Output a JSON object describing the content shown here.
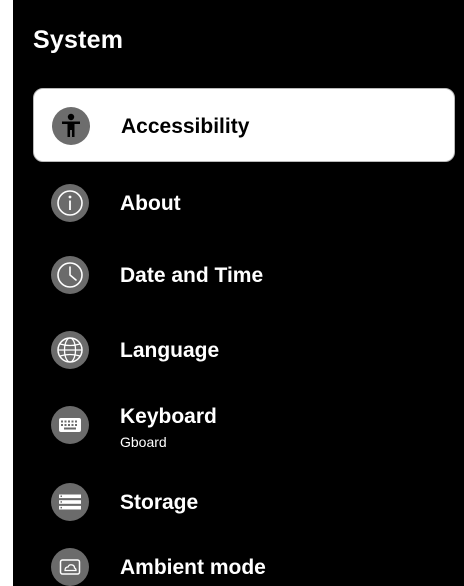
{
  "screen": {
    "title": "System",
    "items": [
      {
        "label": "Accessibility",
        "icon": "accessibility-icon",
        "selected": true
      },
      {
        "label": "About",
        "icon": "info-icon"
      },
      {
        "label": "Date and Time",
        "icon": "clock-icon"
      },
      {
        "label": "Language",
        "icon": "globe-icon"
      },
      {
        "label": "Keyboard",
        "sublabel": "Gboard",
        "icon": "keyboard-icon"
      },
      {
        "label": "Storage",
        "icon": "storage-icon"
      },
      {
        "label": "Ambient mode",
        "icon": "ambient-mode-icon"
      }
    ]
  },
  "colors": {
    "background": "#000000",
    "selected_background": "#ffffff",
    "icon_circle": "#6b6b6b",
    "text_light": "#ffffff",
    "text_dark": "#000000"
  }
}
